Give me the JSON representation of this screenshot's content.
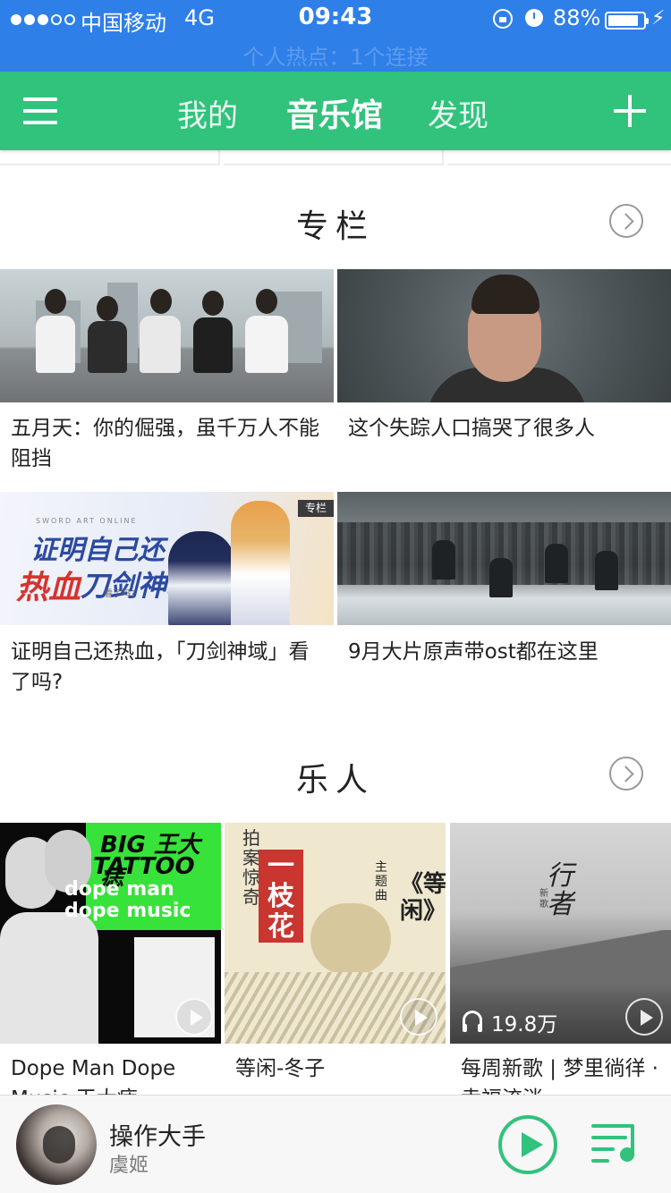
{
  "status_bar": {
    "carrier": "中国移动",
    "network": "4G",
    "time": "09:43",
    "battery_percent": "88%",
    "battery_level": 0.88,
    "hotspot": "个人热点：1个连接",
    "color": "#2f7fe8"
  },
  "nav": {
    "tabs": [
      {
        "label": "我的",
        "active": false
      },
      {
        "label": "音乐馆",
        "active": true
      },
      {
        "label": "发现",
        "active": false
      }
    ],
    "color": "#31c27c",
    "icons": {
      "menu": "hamburger-menu-icon",
      "add": "plus-icon"
    }
  },
  "column": {
    "title": "专栏",
    "badge": "专栏",
    "items": [
      {
        "caption": "五月天：你的倔强，虽千万人不能阻挡"
      },
      {
        "caption": "这个失踪人口搞哭了很多人"
      },
      {
        "caption": "证明自己还热血，「刀剑神域」看了吗?"
      },
      {
        "caption": "9月大片原声带ost都在这里"
      }
    ],
    "art": {
      "anime_line1": "证明自己还",
      "anime_line2": "热血",
      "anime_line3": "刀剑神域",
      "anime_small": "看了吗?",
      "anime_top": "SWORD ART ONLINE"
    }
  },
  "musicians": {
    "title": "乐人",
    "items": [
      {
        "caption": "Dope Man Dope Music 王大痣"
      },
      {
        "caption": "等闲-冬子"
      },
      {
        "caption": "每周新歌 | 梦里徜徉 · 幸福流淌",
        "play_count": "19.8万"
      }
    ],
    "art": {
      "big": "BIG 王大痣",
      "tattoo": "TATTOO",
      "dope1": "dope man",
      "dope2": "dope music",
      "seal": "一枝花",
      "side": "拍案惊奇",
      "sub": "主题曲",
      "title": "《等闲》",
      "calli": "行者",
      "calli_sub": "新歌"
    }
  },
  "player": {
    "song": "操作大手",
    "artist": "虞姬",
    "accent": "#31c27c",
    "icons": {
      "play": "play-circle-icon",
      "playlist": "playlist-icon"
    }
  }
}
